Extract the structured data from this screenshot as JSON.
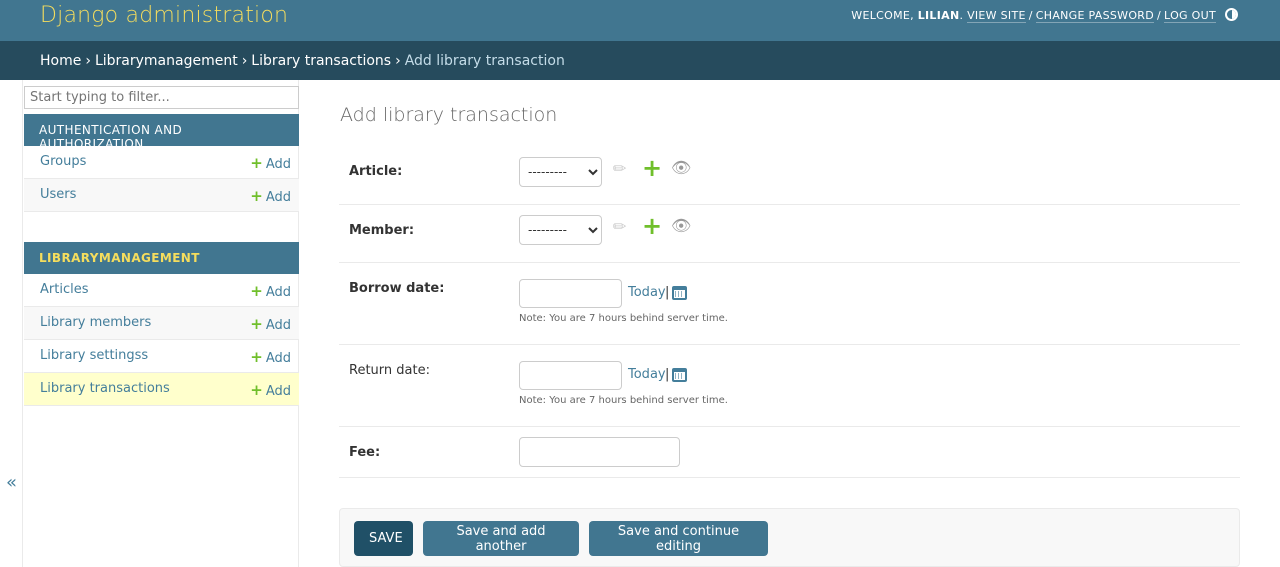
{
  "header": {
    "branding": "Django administration",
    "welcome": "WELCOME,",
    "username": "LILIAN",
    "view_site": "VIEW SITE",
    "change_password": "CHANGE PASSWORD",
    "log_out": "LOG OUT",
    "separator": "/"
  },
  "breadcrumbs": {
    "home": "Home",
    "app": "Librarymanagement",
    "model": "Library transactions",
    "current": "Add library transaction",
    "sep": "›"
  },
  "sidebar": {
    "filter_placeholder": "Start typing to filter...",
    "toggle_label": "«",
    "modules": [
      {
        "caption": "AUTHENTICATION AND AUTHORIZATION",
        "models": [
          {
            "name": "Groups",
            "add": "Add"
          },
          {
            "name": "Users",
            "add": "Add"
          }
        ]
      },
      {
        "caption": "LIBRARYMANAGEMENT",
        "models": [
          {
            "name": "Articles",
            "add": "Add"
          },
          {
            "name": "Library members",
            "add": "Add"
          },
          {
            "name": "Library settingss",
            "add": "Add"
          },
          {
            "name": "Library transactions",
            "add": "Add"
          }
        ]
      }
    ]
  },
  "form": {
    "title": "Add library transaction",
    "article": {
      "label": "Article:",
      "value": "---------"
    },
    "member": {
      "label": "Member:",
      "value": "---------"
    },
    "borrow_date": {
      "label": "Borrow date:",
      "today": "Today",
      "pipe": "|",
      "note": "Note: You are 7 hours behind server time."
    },
    "return_date": {
      "label": "Return date:",
      "today": "Today",
      "pipe": "|",
      "note": "Note: You are 7 hours behind server time."
    },
    "fee": {
      "label": "Fee:"
    }
  },
  "submit": {
    "save": "SAVE",
    "save_add_another": "Save and add another",
    "save_continue": "Save and continue editing"
  },
  "icons": {
    "plus": "+",
    "pencil": "✎",
    "eye": "👁"
  },
  "colors": {
    "header_bg": "#417690",
    "breadcrumb_bg": "#264b5d",
    "brand_yellow": "#f5dd5d",
    "link": "#447e9b",
    "add_green": "#70bf2b",
    "current_row": "#ffffcc"
  }
}
